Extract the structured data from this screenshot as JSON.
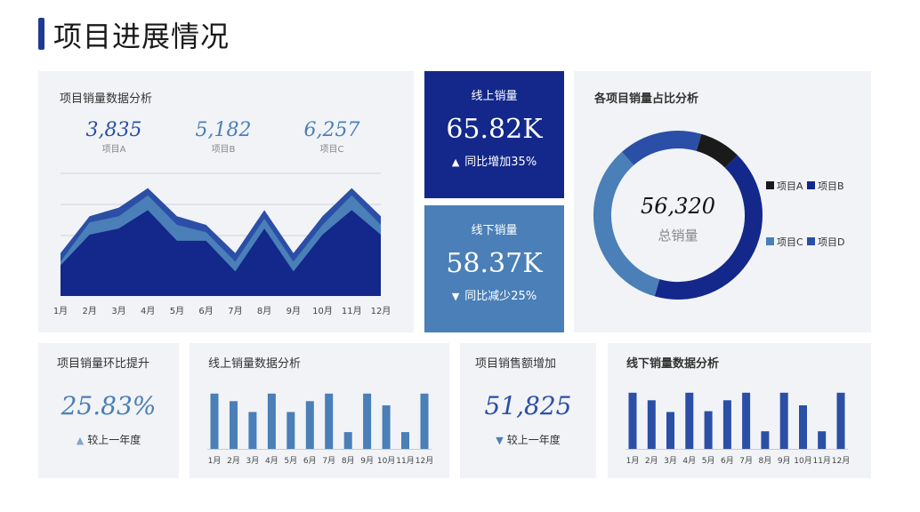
{
  "page": {
    "title": "项目进展情况"
  },
  "colors": {
    "navy": "#13288a",
    "mid": "#2b4fa6",
    "steel": "#4a7fb8",
    "light": "#7ea6cf",
    "black": "#1a1a1a"
  },
  "area_card": {
    "title": "项目销量数据分析",
    "stats": [
      {
        "value": "3,835",
        "label": "项目A"
      },
      {
        "value": "5,182",
        "label": "项目B"
      },
      {
        "value": "6,257",
        "label": "项目C"
      }
    ]
  },
  "online_kpi": {
    "label": "线上销量",
    "value": "65.82K",
    "arrow": "▲",
    "sub": "同比增加35%"
  },
  "offline_kpi": {
    "label": "线下销量",
    "value": "58.37K",
    "arrow": "▼",
    "sub": "同比减少25%"
  },
  "donut_card": {
    "title": "各项目销量占比分析",
    "center_value": "56,320",
    "center_label": "总销量",
    "legend": [
      {
        "name": "项目A",
        "color": "#1a1a1a"
      },
      {
        "name": "项目B",
        "color": "#13288a"
      },
      {
        "name": "项目C",
        "color": "#4a7fb8"
      },
      {
        "name": "项目D",
        "color": "#2b4fa6"
      }
    ]
  },
  "growth_card": {
    "title": "项目销量环比提升",
    "value": "25.83%",
    "arrow": "▲",
    "sub": "较上一年度"
  },
  "online_bar_card": {
    "title": "线上销量数据分析"
  },
  "sales_card": {
    "title": "项目销售额增加",
    "value": "51,825",
    "arrow": "▼",
    "sub": "较上一年度"
  },
  "offline_bar_card": {
    "title": "线下销量数据分析"
  },
  "chart_data": [
    {
      "type": "area",
      "categories": [
        "1月",
        "2月",
        "3月",
        "4月",
        "5月",
        "6月",
        "7月",
        "8月",
        "9月",
        "10月",
        "11月",
        "12月"
      ],
      "ylim": [
        0,
        100
      ],
      "grid": true,
      "series": [
        {
          "values": [
            35,
            65,
            72,
            88,
            65,
            58,
            35,
            70,
            35,
            65,
            88,
            65
          ]
        },
        {
          "values": [
            28,
            60,
            65,
            82,
            58,
            52,
            28,
            63,
            28,
            58,
            82,
            58
          ]
        },
        {
          "values": [
            25,
            50,
            55,
            70,
            45,
            45,
            20,
            55,
            20,
            50,
            70,
            50
          ]
        }
      ]
    },
    {
      "type": "pie",
      "categories": [
        "项目A",
        "项目B",
        "项目C",
        "项目D"
      ],
      "values": [
        8,
        42,
        34,
        16
      ]
    },
    {
      "type": "bar",
      "categories": [
        "1月",
        "2月",
        "3月",
        "4月",
        "5月",
        "6月",
        "7月",
        "8月",
        "9月",
        "10月",
        "11月",
        "12月"
      ],
      "values": [
        66,
        57,
        44,
        66,
        44,
        57,
        66,
        20,
        66,
        52,
        20,
        66
      ],
      "ylim": [
        0,
        70
      ]
    },
    {
      "type": "bar",
      "categories": [
        "1月",
        "2月",
        "3月",
        "4月",
        "5月",
        "6月",
        "7月",
        "8月",
        "9月",
        "10月",
        "11月",
        "12月"
      ],
      "values": [
        67,
        58,
        44,
        67,
        45,
        58,
        67,
        21,
        67,
        52,
        21,
        67
      ],
      "ylim": [
        0,
        70
      ]
    }
  ]
}
